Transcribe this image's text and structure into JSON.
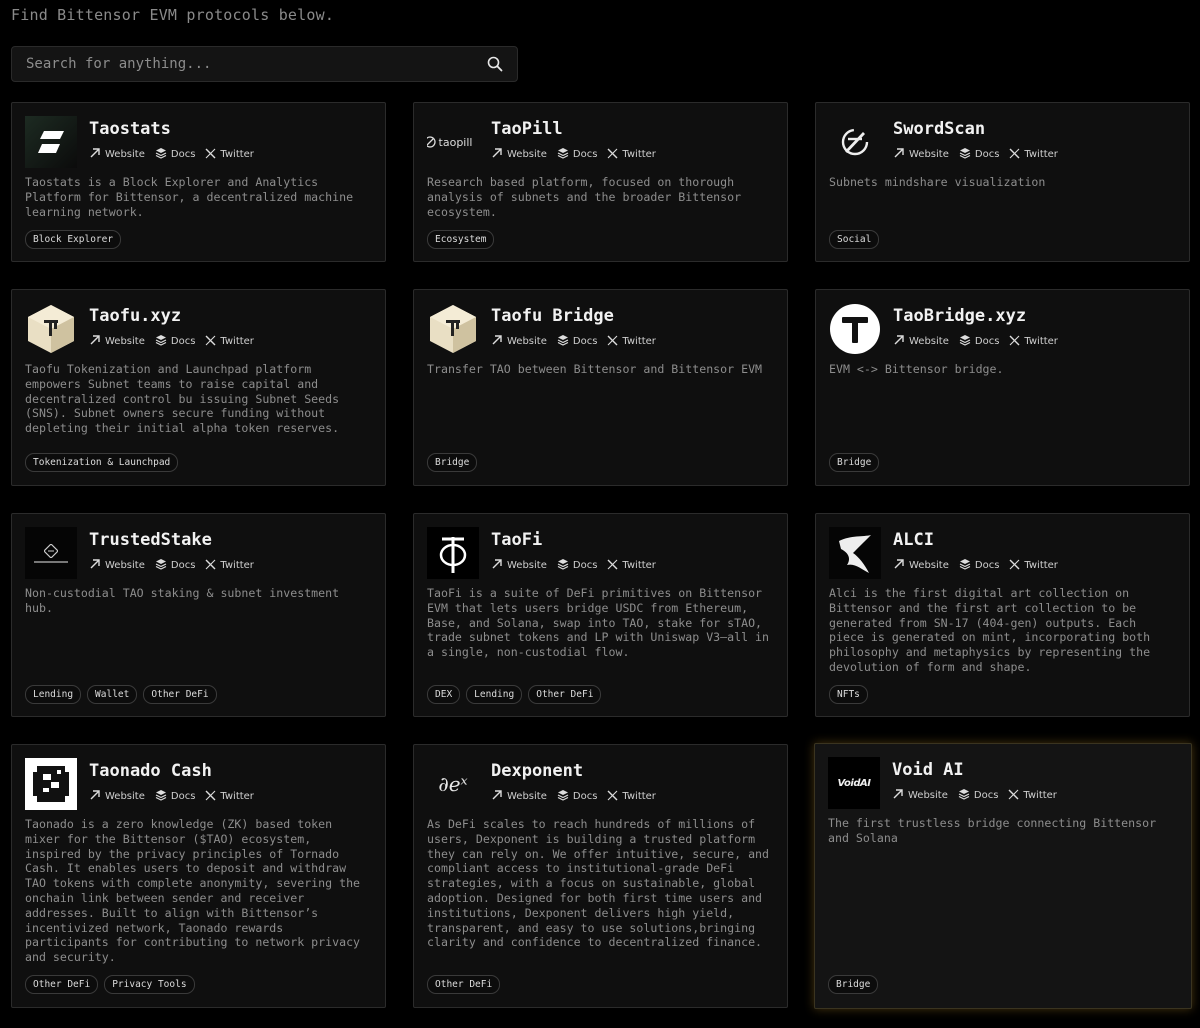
{
  "intro": "Find Bittensor EVM protocols below.",
  "search": {
    "placeholder": "Search for anything..."
  },
  "link_labels": {
    "website": "Website",
    "docs": "Docs",
    "twitter": "Twitter"
  },
  "cards": [
    {
      "title": "Taostats",
      "logo": "taostats-logo",
      "desc": "Taostats is a Block Explorer and Analytics Platform for Bittensor, a decentralized machine learning network.",
      "tags": [
        "Block Explorer"
      ]
    },
    {
      "title": "TaoPill",
      "logo": "taopill-logo",
      "logo_text": "taopill",
      "desc": "Research based platform, focused on thorough analysis of subnets and the broader Bittensor ecosystem.",
      "tags": [
        "Ecosystem"
      ]
    },
    {
      "title": "SwordScan",
      "logo": "swordscan-logo",
      "desc": "Subnets mindshare visualization",
      "tags": [
        "Social"
      ]
    },
    {
      "title": "Taofu.xyz",
      "logo": "taofu-logo",
      "desc": "Taofu Tokenization and Launchpad platform empowers Subnet teams to raise capital and decentralized control bu issuing Subnet Seeds (SNS). Subnet owners secure funding without depleting their initial alpha token reserves.",
      "tags": [
        "Tokenization & Launchpad"
      ]
    },
    {
      "title": "Taofu Bridge",
      "logo": "taofu-logo",
      "desc": "Transfer TAO between Bittensor and Bittensor EVM",
      "tags": [
        "Bridge"
      ]
    },
    {
      "title": "TaoBridge.xyz",
      "logo": "taobridge-logo",
      "desc": "EVM <-> Bittensor bridge.",
      "tags": [
        "Bridge"
      ]
    },
    {
      "title": "TrustedStake",
      "logo": "trustedstake-logo",
      "desc": "Non-custodial TAO staking & subnet investment hub.",
      "tags": [
        "Lending",
        "Wallet",
        "Other DeFi"
      ]
    },
    {
      "title": "TaoFi",
      "logo": "taofi-logo",
      "desc": "TaoFi is a suite of DeFi primitives on Bittensor EVM that lets users bridge USDC from Ethereum, Base, and Solana, swap into TAO, stake for sTAO, trade subnet tokens and LP with Uniswap V3—all in a single, non-custodial flow.",
      "tags": [
        "DEX",
        "Lending",
        "Other DeFi"
      ]
    },
    {
      "title": "ALCI",
      "logo": "alci-logo",
      "desc": "Alci is the first digital art collection on Bittensor and the first art collection to be generated from SN-17 (404-gen) outputs. Each piece is generated on mint, incorporating both philosophy and metaphysics by representing the devolution of form and shape.",
      "tags": [
        "NFTs"
      ]
    },
    {
      "title": "Taonado Cash",
      "logo": "taonado-logo",
      "desc": "Taonado is a zero knowledge (ZK) based token mixer for the Bittensor ($TAO) ecosystem, inspired by the privacy principles of Tornado Cash. It enables users to deposit and withdraw TAO tokens with complete anonymity, severing the onchain link between sender and receiver addresses. Built to align with Bittensor’s incentivized network, Taonado rewards participants for contributing to network privacy and security.",
      "tags": [
        "Other DeFi",
        "Privacy Tools"
      ]
    },
    {
      "title": "Dexponent",
      "logo": "dexponent-logo",
      "logo_text": "∂eˣ",
      "desc": "As DeFi scales to reach hundreds of millions of users, Dexponent is building a trusted platform they can rely on. We offer intuitive, secure, and compliant access to institutional-grade DeFi strategies, with a focus on sustainable, global adoption. Designed for both first time users and institutions, Dexponent delivers high yield, transparent, and easy to use solutions,bringing clarity and confidence to decentralized finance.",
      "tags": [
        "Other DeFi"
      ]
    },
    {
      "title": "Void AI",
      "logo": "voidai-logo",
      "logo_text": "VoidAI",
      "desc": "The first trustless bridge connecting Bittensor and Solana",
      "tags": [
        "Bridge"
      ]
    }
  ]
}
